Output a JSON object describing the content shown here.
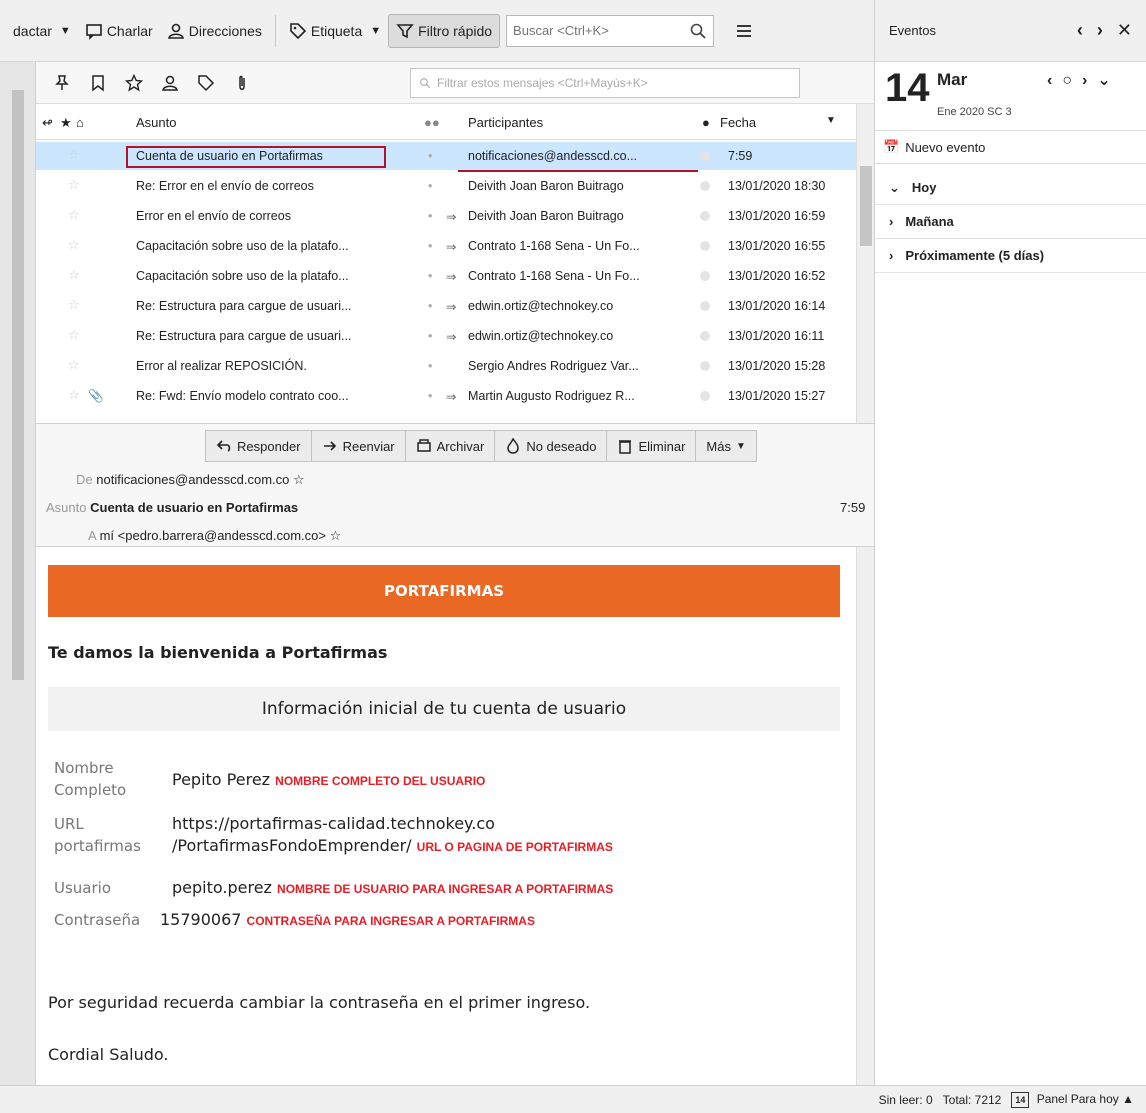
{
  "toolbar": {
    "write_label": "dactar",
    "chat_label": "Charlar",
    "address_label": "Direcciones",
    "tag_label": "Etiqueta",
    "quickfilter_label": "Filtro rápido",
    "search_placeholder": "Buscar <Ctrl+K>"
  },
  "quickfilter": {
    "filter_placeholder": "Filtrar estos mensajes <Ctrl+Mayús+K>"
  },
  "columns": {
    "subject": "Asunto",
    "participants": "Participantes",
    "date": "Fecha"
  },
  "messages": [
    {
      "subject": "Cuenta de usuario en Portafirmas",
      "arrow": "",
      "participant": "notificaciones@andesscd.co...",
      "date": "7:59"
    },
    {
      "subject": "Re: Error en el envío de correos",
      "arrow": "",
      "participant": "Deivith Joan Baron Buitrago",
      "date": "13/01/2020 18:30"
    },
    {
      "subject": "Error en el envío de correos",
      "arrow": "⇒",
      "participant": "Deivith Joan Baron Buitrago",
      "date": "13/01/2020 16:59"
    },
    {
      "subject": "Capacitación sobre uso de la platafo...",
      "arrow": "⇒",
      "participant": "Contrato 1-168 Sena - Un Fo...",
      "date": "13/01/2020 16:55"
    },
    {
      "subject": "Capacitación sobre uso de la platafo...",
      "arrow": "⇒",
      "participant": "Contrato 1-168 Sena - Un Fo...",
      "date": "13/01/2020 16:52"
    },
    {
      "subject": "Re: Estructura para cargue de usuari...",
      "arrow": "⇒",
      "participant": "edwin.ortiz@technokey.co",
      "date": "13/01/2020 16:14"
    },
    {
      "subject": "Re: Estructura para cargue de usuari...",
      "arrow": "⇒",
      "participant": "edwin.ortiz@technokey.co",
      "date": "13/01/2020 16:11"
    },
    {
      "subject": "Error al realizar REPOSICIÓN.",
      "arrow": "",
      "participant": "Sergio Andres Rodriguez Var...",
      "date": "13/01/2020 15:28"
    },
    {
      "subject": "Re: Fwd: Envío modelo contrato coo...",
      "arrow": "⇒",
      "participant": "Martin Augusto Rodriguez R...",
      "date": "13/01/2020 15:27"
    }
  ],
  "actions": {
    "reply": "Responder",
    "forward": "Reenviar",
    "archive": "Archivar",
    "junk": "No deseado",
    "delete": "Eliminar",
    "more": "Más"
  },
  "header": {
    "from_label": "De",
    "from_value": "notificaciones@andesscd.com.co",
    "subject_label": "Asunto",
    "subject_value": "Cuenta de usuario en Portafirmas",
    "time": "7:59",
    "to_label": "A",
    "to_value": "mí <pedro.barrera@andesscd.com.co>"
  },
  "email": {
    "banner": "PORTAFIRMAS",
    "welcome": "Te damos la bienvenida a Portafirmas",
    "info_title": "Información inicial de tu cuenta de usuario",
    "name_label_1": "Nombre",
    "name_label_2": "Completo",
    "name_value": "Pepito Perez",
    "name_note": "NOMBRE COMPLETO DEL USUARIO",
    "url_label_1": "URL",
    "url_label_2": "portafirmas",
    "url_value_1": "https://portafirmas-calidad.technokey.co",
    "url_value_2": "/PortafirmasFondoEmprender/",
    "url_note": "URL O PAGINA DE PORTAFIRMAS",
    "user_label": "Usuario",
    "user_value": "pepito.perez",
    "user_note": "NOMBRE DE USUARIO PARA INGRESAR A PORTAFIRMAS",
    "pass_label": "Contraseña",
    "pass_value": "15790067",
    "pass_note": "CONTRASEÑA PARA INGRESAR A PORTAFIRMAS",
    "security": "Por seguridad recuerda cambiar la contraseña en el primer ingreso.",
    "closing": "Cordial Saludo."
  },
  "events": {
    "title": "Eventos",
    "day": "14",
    "month": "Mar",
    "sub": "Ene 2020  SC 3",
    "new_event": "Nuevo evento",
    "today": "Hoy",
    "tomorrow": "Mañana",
    "upcoming": "Próximamente (5 días)"
  },
  "status": {
    "unread": "Sin leer: 0",
    "total": "Total: 7212",
    "today_badge": "14",
    "today_pane": "Panel Para hoy"
  }
}
